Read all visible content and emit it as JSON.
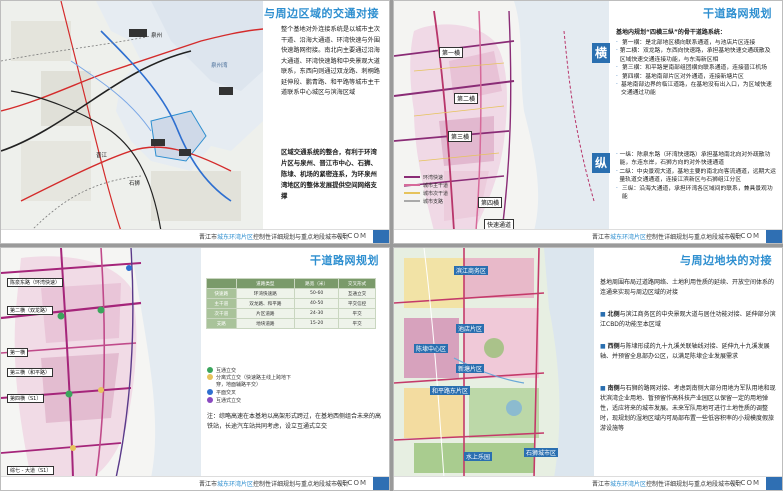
{
  "footer": {
    "prefix": "晋江市",
    "highlight": "城东环湾片区",
    "suffix": "控制性详细规划与重点地段城市设计",
    "brand": "AECOM"
  },
  "slide1": {
    "title": "与周边区域的交通对接",
    "para1": "整个基地对外连接系统是以城市主次干道、沿海大通道、环湾快速与外围快速路网衔接。南北向主要通过沿海大通道、环湾快速路和中央景观大道联系，东西向则通过双龙路、刺桐路延伸段、鹏青路、和平路等城市主干道联系中心城区与滨海区域",
    "para2": "区域交通系统的整合，有利于环湾片区与泉州、晋江市中心、石狮、陈埭、机场的紧密连系，为环泉州湾地区的整体发展提供空间网络支撑",
    "map_labels": [
      "泉州",
      "泉州湾",
      "晋江",
      "石狮"
    ]
  },
  "slide2": {
    "title": "干道路网规划",
    "heading": "基地内规划“四横三纵”的骨干道路系统：",
    "heng_char": "横",
    "zong_char": "纵",
    "heng_items": [
      "第一横：是北部地区横向联系通道，与池店片区连接",
      "第二横：双龙路，东西向快速路，承担基地快速交通疏散及区域快速交通连接功能，与东海新区相",
      "第三横：和平路是南部组团横向联系通道，连接晋江机场",
      "第四横：基地南部片区对外通道，连接新塘片区",
      "基地南部边界的临江道路，在基地没有出入口，为区域快速交通通过功能"
    ],
    "zong_items": [
      "一纵：陈泉东路（环湾快速路）承担基地南北向对外疏散功能，东连东岸，石狮方向的对外快速通道",
      "二纵：中央景观大道，基地主要的南北向客流通道，远期大运量轨道交通通道，连接江滨新区与石狮组江分区",
      "三纵：沿海大通道，承担环湾各区域间的联系，兼具景观功能"
    ],
    "road_labels": [
      "第一横",
      "第二横",
      "第三横",
      "第四横",
      "快速通道"
    ],
    "legend": [
      "环湾快速",
      "城市主干道",
      "城市次干道",
      "城市支路"
    ]
  },
  "slide3": {
    "title": "干道路网规划",
    "table_header": [
      "",
      "道路类型",
      "路宽（米）",
      "交叉形式"
    ],
    "table_rows": [
      [
        "快速路",
        "环湾快速路",
        "50-60",
        "互通立交"
      ],
      [
        "主干道",
        "双龙路、和平路",
        "40-50",
        "平交信控"
      ],
      [
        "次干道",
        "片区道路",
        "24-30",
        "平交"
      ],
      [
        "支路",
        "地块道路",
        "15-20",
        "平交"
      ]
    ],
    "legend": [
      "互通立交",
      "分离式立交（快速路主线上跨地下穿，地面辅路平交）",
      "平面交叉",
      "互通式立交"
    ],
    "note": "注：综略高速在本基地以高架形式跨过，在基地西侧组合未来的高铁站，长途汽车站共同考虑，设立互通式立交",
    "road_tags": [
      "陈泉东路（环湾快速）",
      "第二横（双龙路）",
      "第一横",
      "第三横（和平路）",
      "第四横（S1）",
      "综七 - 大道（S1）"
    ]
  },
  "slide4": {
    "title": "与周边地块的对接",
    "intro": "基地周围布局过道路网络、土地利用性质的延续、开放空间体系的连通来实现与周边区域的对接",
    "north_key": "北侧",
    "north": "与滨江商务区的中央景观大道与居住功能对接、延伸部分滨江CBD的功能至本区域",
    "west_key": "西侧",
    "west": "与陈埭形成的九十九溪关联轴线对接、延伸九十九溪发展轴、并预留全息部办公区，以满足陈埭企业发展需求",
    "south_key": "南侧",
    "south": "与石狮的路网对接、考虑到南侧大部分用地为军队用地和现状滨湾企业用地、暂预留作高科技产业园区以保留一定的用地弹性，适应将来的城市发展。未来军队用地可进行土地性质的调整时，现规划的湿地区域内可局部布置一些低容积率的小规模度假旅游设施等",
    "map_labels": [
      "滨江商务区",
      "池店片区",
      "陈埭中心区",
      "新塘片区",
      "和平路东片区",
      "石狮城市区",
      "水上乐园"
    ]
  }
}
